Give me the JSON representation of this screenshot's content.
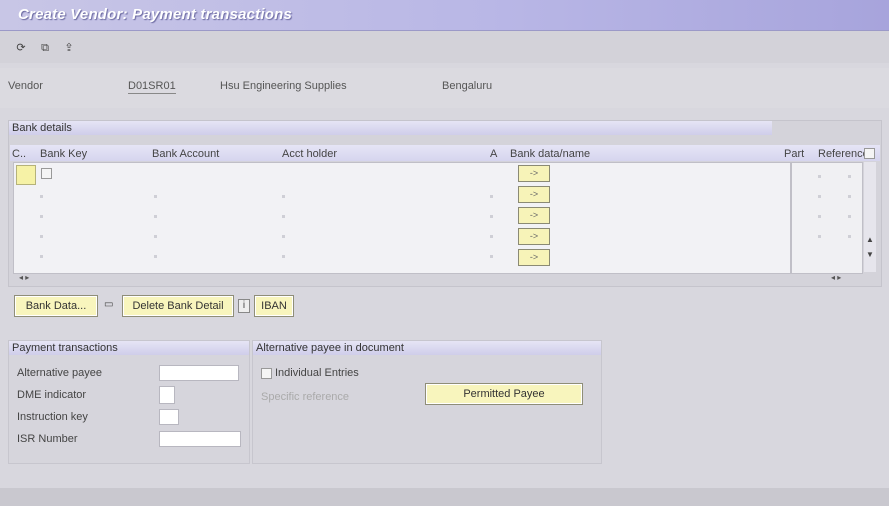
{
  "window": {
    "title": "Create Vendor: Payment transactions"
  },
  "toolbar": {
    "icons": [
      "refresh-icon",
      "copy-icon",
      "export-icon"
    ]
  },
  "header": {
    "vendor_label": "Vendor",
    "vendor_id": "D01SR01",
    "vendor_name": "Hsu Engineering Supplies",
    "city": "Bengaluru"
  },
  "bank_details": {
    "section_title": "Bank details",
    "columns": [
      "C..",
      "Bank Key",
      "Bank Account",
      "Acct holder",
      "A",
      "Bank data/name",
      "Part",
      "Reference"
    ],
    "rows": 5,
    "bank_data_button": "->"
  },
  "actions": {
    "bank_data": "Bank Data...",
    "delete_bank": "Delete Bank Detail",
    "iban": "IBAN"
  },
  "payment_transactions": {
    "section_title": "Payment transactions",
    "fields": [
      {
        "label": "Alternative payee",
        "value": ""
      },
      {
        "label": "DME indicator",
        "value": ""
      },
      {
        "label": "Instruction key",
        "value": ""
      },
      {
        "label": "ISR Number",
        "value": ""
      }
    ]
  },
  "alt_payee": {
    "section_title": "Alternative payee in document",
    "individual_spec": "Individual Entries",
    "spec_ref": "Specific reference",
    "permitted_payee": "Permitted Payee"
  }
}
